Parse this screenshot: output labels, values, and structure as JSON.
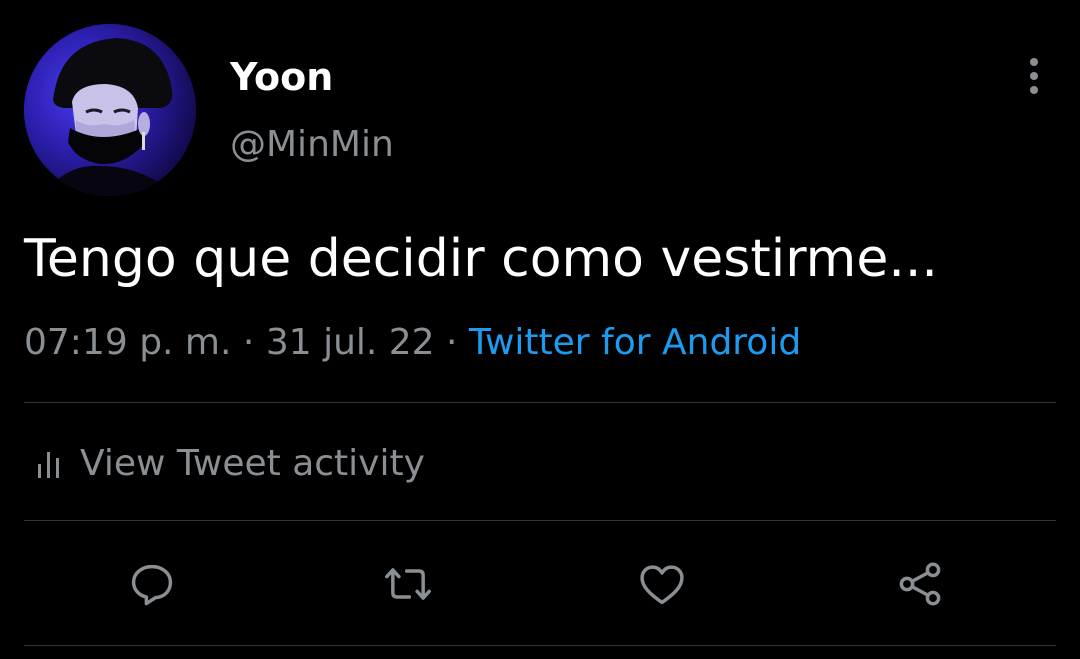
{
  "tweet": {
    "author": {
      "display_name": "Yoon",
      "handle": "@MinMin"
    },
    "text": "Tengo que decidir como vestirme...",
    "meta": {
      "time": "07:19 p. m.",
      "separator": "·",
      "date": "31 jul. 22",
      "source": "Twitter for Android"
    },
    "activity_label": "View Tweet activity"
  },
  "icons": {
    "more": "more-vertical-icon",
    "activity": "bar-chart-icon",
    "reply": "reply-icon",
    "retweet": "retweet-icon",
    "like": "heart-icon",
    "share": "share-icon"
  },
  "colors": {
    "background": "#000000",
    "text_primary": "#ffffff",
    "text_secondary": "#8a8f94",
    "link": "#1d9bf0",
    "divider": "#2f3336"
  }
}
